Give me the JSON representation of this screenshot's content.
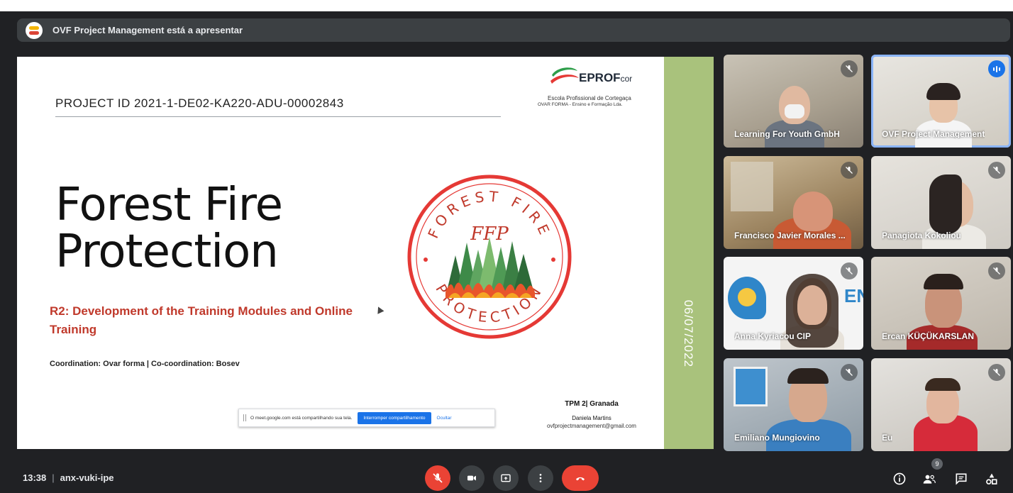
{
  "presenter_bar": {
    "text": "OVF Project Management está a apresentar",
    "logo_icon": "presenter-avatar-icon"
  },
  "slide": {
    "project_id": "PROJECT ID 2021-1-DE02-KA220-ADU-00002843",
    "org_brand": "EPROF",
    "org_brand_suffix": "cor",
    "org_line1": "Escola Profissional de Cortegaça",
    "org_line2": "OVAR FORMA - Ensino e Formação Lda.",
    "title_line1": "Forest Fire",
    "title_line2": "Protection",
    "subtitle": "R2: Development of the Training Modules and Online Training",
    "coordination": "Coordination: Ovar forma | Co-coordination: Bosev",
    "badge_top": "FOREST FIRE",
    "badge_bottom": "PROTECTION",
    "badge_monogram": "FFP",
    "tpm": "TPM 2| Granada",
    "author": "Daniela Martins",
    "email": "ovfprojectmanagement@gmail.com",
    "date": "06/07/2022",
    "accent_color": "#c0392b",
    "band_color": "#a9c27c"
  },
  "share_banner": {
    "message": "O meet.google.com está compartilhando sua tela.",
    "stop_label": "Interromper compartilhamento",
    "hide_label": "Ocultar"
  },
  "participants": [
    {
      "name": "Learning For Youth GmbH",
      "muted": true
    },
    {
      "name": "OVF Project Management",
      "muted": false,
      "speaking": true
    },
    {
      "name": "Francisco Javier Morales ...",
      "muted": true
    },
    {
      "name": "Panagiota Kokoliou",
      "muted": true
    },
    {
      "name": "Anna Kyriacou CIP",
      "muted": true
    },
    {
      "name": "Ercan KÜÇÜKARSLAN",
      "muted": true
    },
    {
      "name": "Emiliano Mungiovino",
      "muted": true
    },
    {
      "name": "Eu",
      "muted": true
    }
  ],
  "bottom_bar": {
    "time": "13:38",
    "meeting_code": "anx-vuki-ipe",
    "participant_count": "9",
    "controls": [
      "mic-off-icon",
      "camera-icon",
      "present-icon",
      "more-icon",
      "end-call-icon"
    ],
    "right_icons": [
      "info-icon",
      "people-icon",
      "chat-icon",
      "activities-icon"
    ]
  }
}
